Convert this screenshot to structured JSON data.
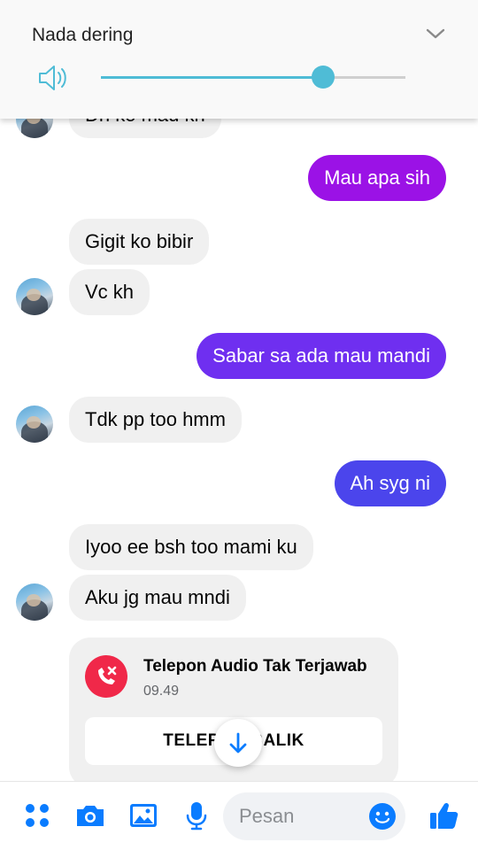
{
  "volume": {
    "title": "Nada dering",
    "level": 0.73,
    "accent_color": "#4fbcd6",
    "icons": {
      "speaker": "speaker-icon",
      "collapse": "chevron-down-icon"
    }
  },
  "messages": [
    {
      "side": "in",
      "text": "Dh ko mau kh"
    },
    {
      "side": "out",
      "text": "Mau apa sih",
      "color": "#9b12e6"
    },
    {
      "side": "in",
      "text": "Gigit ko bibir"
    },
    {
      "side": "in",
      "text": "Vc kh"
    },
    {
      "side": "out",
      "text": "Sabar sa ada mau mandi",
      "color": "#6f2ff0"
    },
    {
      "side": "in",
      "text": "Tdk pp too hmm"
    },
    {
      "side": "out",
      "text": "Ah syg ni",
      "color": "#4b45ec"
    },
    {
      "side": "in",
      "text": "Iyoo ee bsh too mami ku"
    },
    {
      "side": "in",
      "text": "Aku jg mau mndi"
    }
  ],
  "missed_call": {
    "title": "Telepon Audio Tak Terjawab",
    "time": "09.49",
    "callback_label": "TELEPON BALIK",
    "icon_color": "#f02849"
  },
  "composer": {
    "placeholder": "Pesan",
    "accent_color": "#0a7cff",
    "icons": [
      "apps-icon",
      "camera-icon",
      "gallery-icon",
      "microphone-icon",
      "emoji-icon",
      "thumbs-up-icon"
    ]
  }
}
